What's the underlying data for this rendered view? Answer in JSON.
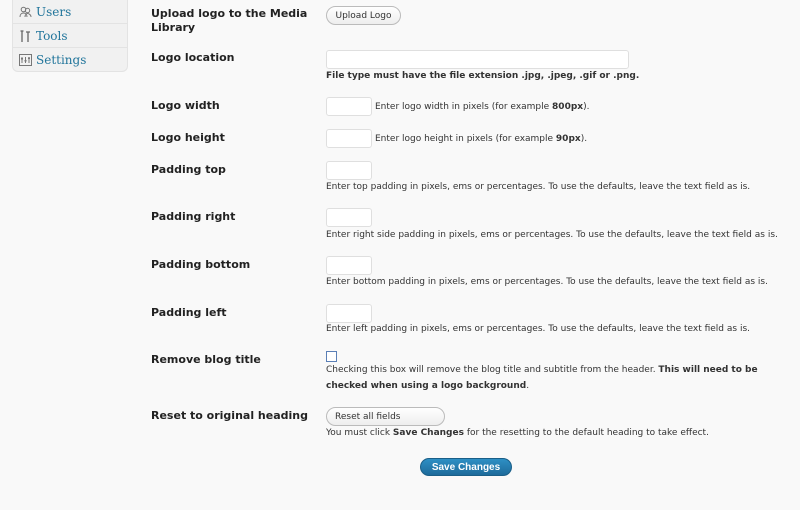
{
  "sidebar": {
    "items": [
      {
        "label": "Users",
        "icon": "users-icon"
      },
      {
        "label": "Tools",
        "icon": "tools-icon"
      },
      {
        "label": "Settings",
        "icon": "settings-icon"
      }
    ]
  },
  "form": {
    "upload": {
      "label": "Upload logo to the Media Library",
      "button": "Upload Logo"
    },
    "location": {
      "label": "Logo location",
      "value": "",
      "desc": "File type must have the file extension .jpg, .jpeg, .gif or .png."
    },
    "width": {
      "label": "Logo width",
      "value": "",
      "desc_pre": "Enter logo width in pixels (for example ",
      "desc_bold": "800px",
      "desc_post": ")."
    },
    "height": {
      "label": "Logo height",
      "value": "",
      "desc_pre": "Enter logo height in pixels (for example ",
      "desc_bold": "90px",
      "desc_post": ")."
    },
    "padding_top": {
      "label": "Padding top",
      "value": "",
      "desc": "Enter top padding in pixels, ems or percentages. To use the defaults, leave the text field as is."
    },
    "padding_right": {
      "label": "Padding right",
      "value": "",
      "desc": "Enter right side padding in pixels, ems or percentages. To use the defaults, leave the text field as is."
    },
    "padding_bottom": {
      "label": "Padding bottom",
      "value": "",
      "desc": "Enter bottom padding in pixels, ems or percentages. To use the defaults, leave the text field as is."
    },
    "padding_left": {
      "label": "Padding left",
      "value": "",
      "desc": "Enter left padding in pixels, ems or percentages. To use the defaults, leave the text field as is."
    },
    "remove_title": {
      "label": "Remove blog title",
      "checked": false,
      "desc_pre": "Checking this box will remove the blog title and subtitle from the header. ",
      "desc_bold": "This will need to be checked when using a logo background",
      "desc_post": "."
    },
    "reset": {
      "label": "Reset to original heading",
      "button": "Reset all fields",
      "desc_pre": "You must click ",
      "desc_bold": "Save Changes",
      "desc_post": " for the resetting to the default heading to take effect."
    },
    "save_button": "Save Changes"
  },
  "colors": {
    "accent": "#21759b",
    "primary_button": "#2e8fc4"
  }
}
